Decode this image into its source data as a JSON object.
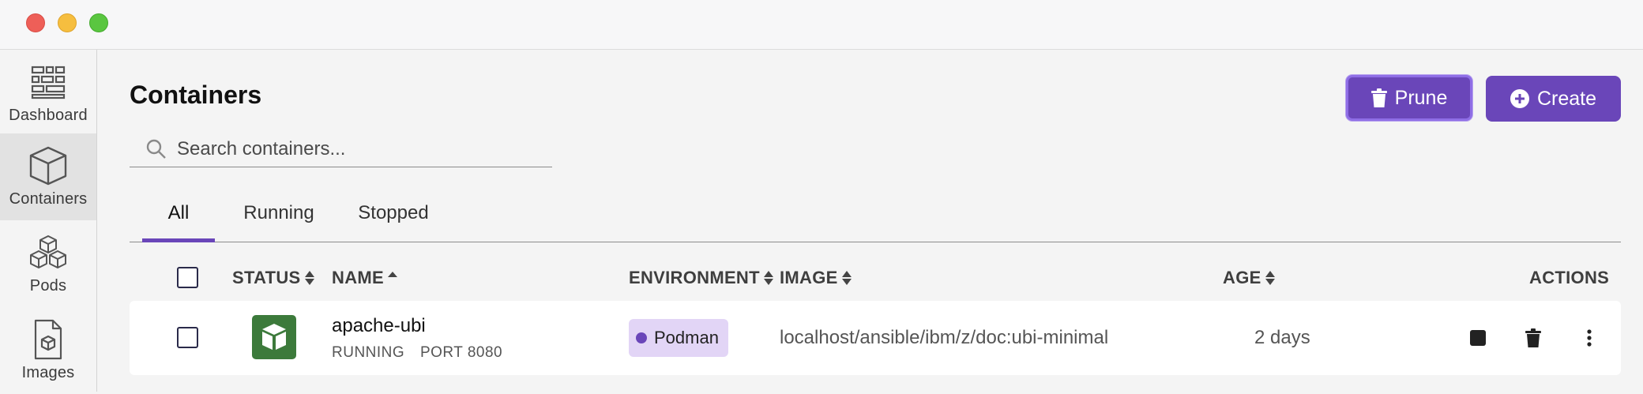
{
  "window": {
    "controls": [
      "close",
      "minimize",
      "maximize"
    ]
  },
  "sidebar": {
    "items": [
      {
        "label": "Dashboard",
        "icon": "dashboard-icon",
        "active": false
      },
      {
        "label": "Containers",
        "icon": "container-box-icon",
        "active": true
      },
      {
        "label": "Pods",
        "icon": "pods-icon",
        "active": false
      },
      {
        "label": "Images",
        "icon": "image-file-icon",
        "active": false
      }
    ]
  },
  "page": {
    "title": "Containers"
  },
  "toolbar": {
    "prune_label": "Prune",
    "create_label": "Create"
  },
  "search": {
    "placeholder": "Search containers...",
    "value": ""
  },
  "tabs": [
    {
      "label": "All",
      "active": true
    },
    {
      "label": "Running",
      "active": false
    },
    {
      "label": "Stopped",
      "active": false
    }
  ],
  "table": {
    "columns": {
      "status": "STATUS",
      "name": "NAME",
      "environment": "ENVIRONMENT",
      "image": "IMAGE",
      "age": "AGE",
      "actions": "ACTIONS"
    },
    "rows": [
      {
        "name": "apache-ubi",
        "state": "RUNNING",
        "port": "PORT 8080",
        "environment": "Podman",
        "image": "localhost/ansible/ibm/z/doc:ubi-minimal",
        "age": "2 days"
      }
    ]
  },
  "colors": {
    "accent": "#6a46b9",
    "running_status": "#3c7a3b",
    "env_badge_bg": "#e2d5f6"
  }
}
